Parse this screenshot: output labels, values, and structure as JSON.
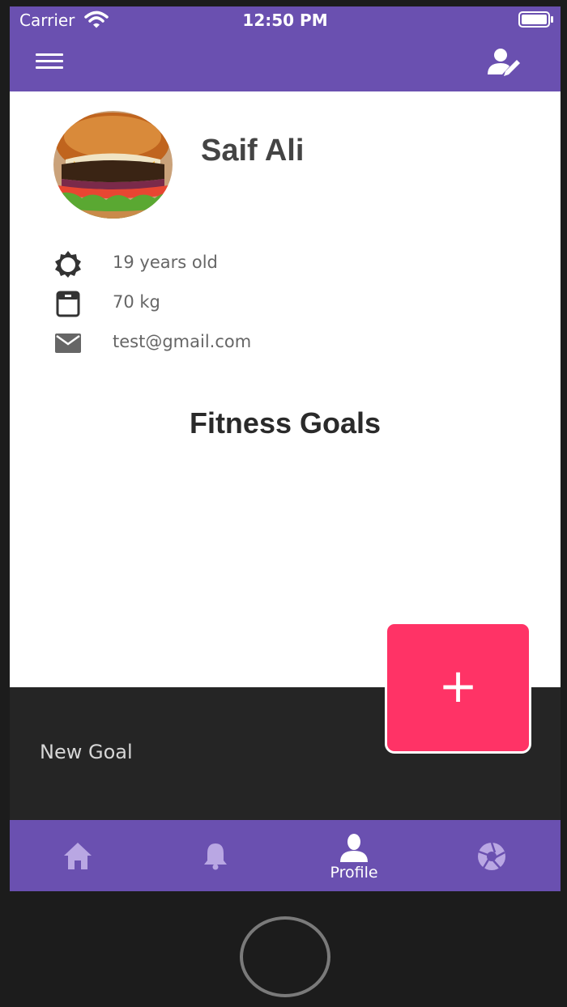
{
  "status_bar": {
    "carrier": "Carrier",
    "time": "12:50 PM"
  },
  "app_bar": {
    "menu_icon": "menu-icon",
    "edit_icon": "edit-profile-icon"
  },
  "profile": {
    "name": "Saif Ali",
    "details": [
      {
        "icon": "sun-icon",
        "text": "19 years old"
      },
      {
        "icon": "scale-icon",
        "text": "70 kg"
      },
      {
        "icon": "email-icon",
        "text": "test@gmail.com"
      }
    ]
  },
  "goals": {
    "title": "Fitness Goals"
  },
  "sheet": {
    "label": "New Goal"
  },
  "fab": {
    "label": "+"
  },
  "tabs": [
    {
      "icon": "home-icon",
      "label": ""
    },
    {
      "icon": "bell-icon",
      "label": ""
    },
    {
      "icon": "person-icon",
      "label": "Profile",
      "active": true
    },
    {
      "icon": "aperture-icon",
      "label": ""
    }
  ],
  "colors": {
    "primary": "#6a50b0",
    "accent": "#ff3366",
    "sheet": "#252525"
  }
}
